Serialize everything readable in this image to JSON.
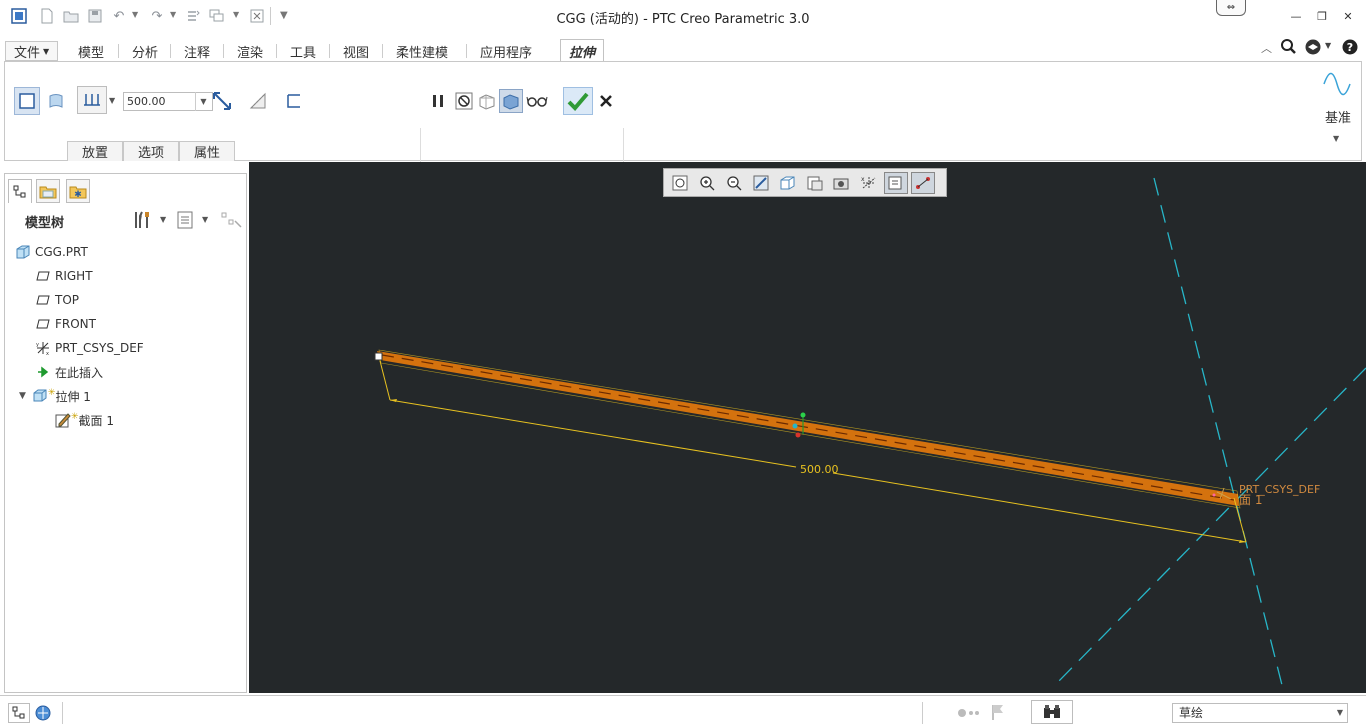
{
  "app": {
    "title": "CGG (活动的) - PTC Creo Parametric 3.0"
  },
  "tabs": {
    "file": "文件",
    "items": [
      "模型",
      "分析",
      "注释",
      "渲染",
      "工具",
      "视图",
      "柔性建模",
      "应用程序"
    ],
    "active": "拉伸"
  },
  "ribbon": {
    "depth_value": "500.00",
    "subtabs": [
      "放置",
      "选项",
      "属性"
    ],
    "datum_label": "基准"
  },
  "model_tree": {
    "title": "模型树",
    "items": [
      {
        "label": "CGG.PRT",
        "icon": "part-icon"
      },
      {
        "label": "RIGHT",
        "icon": "datum-plane-icon"
      },
      {
        "label": "TOP",
        "icon": "datum-plane-icon"
      },
      {
        "label": "FRONT",
        "icon": "datum-plane-icon"
      },
      {
        "label": "PRT_CSYS_DEF",
        "icon": "csys-icon"
      },
      {
        "label": "在此插入",
        "icon": "insert-arrow-icon"
      },
      {
        "label": "拉伸 1",
        "icon": "extrude-icon"
      },
      {
        "label": "截面 1",
        "icon": "sketch-icon"
      }
    ]
  },
  "graphics": {
    "dimension_label": "500.00",
    "csys_label": "PRT_CSYS_DEF",
    "section_label": "面 1"
  },
  "status": {
    "filter_value": "草绘"
  },
  "colors": {
    "graphics_bg": "#24282a",
    "extrude": "#e07a10",
    "dimension": "#e8c220",
    "datum_line": "#27b6c8",
    "accept_green": "#2f9a36"
  }
}
